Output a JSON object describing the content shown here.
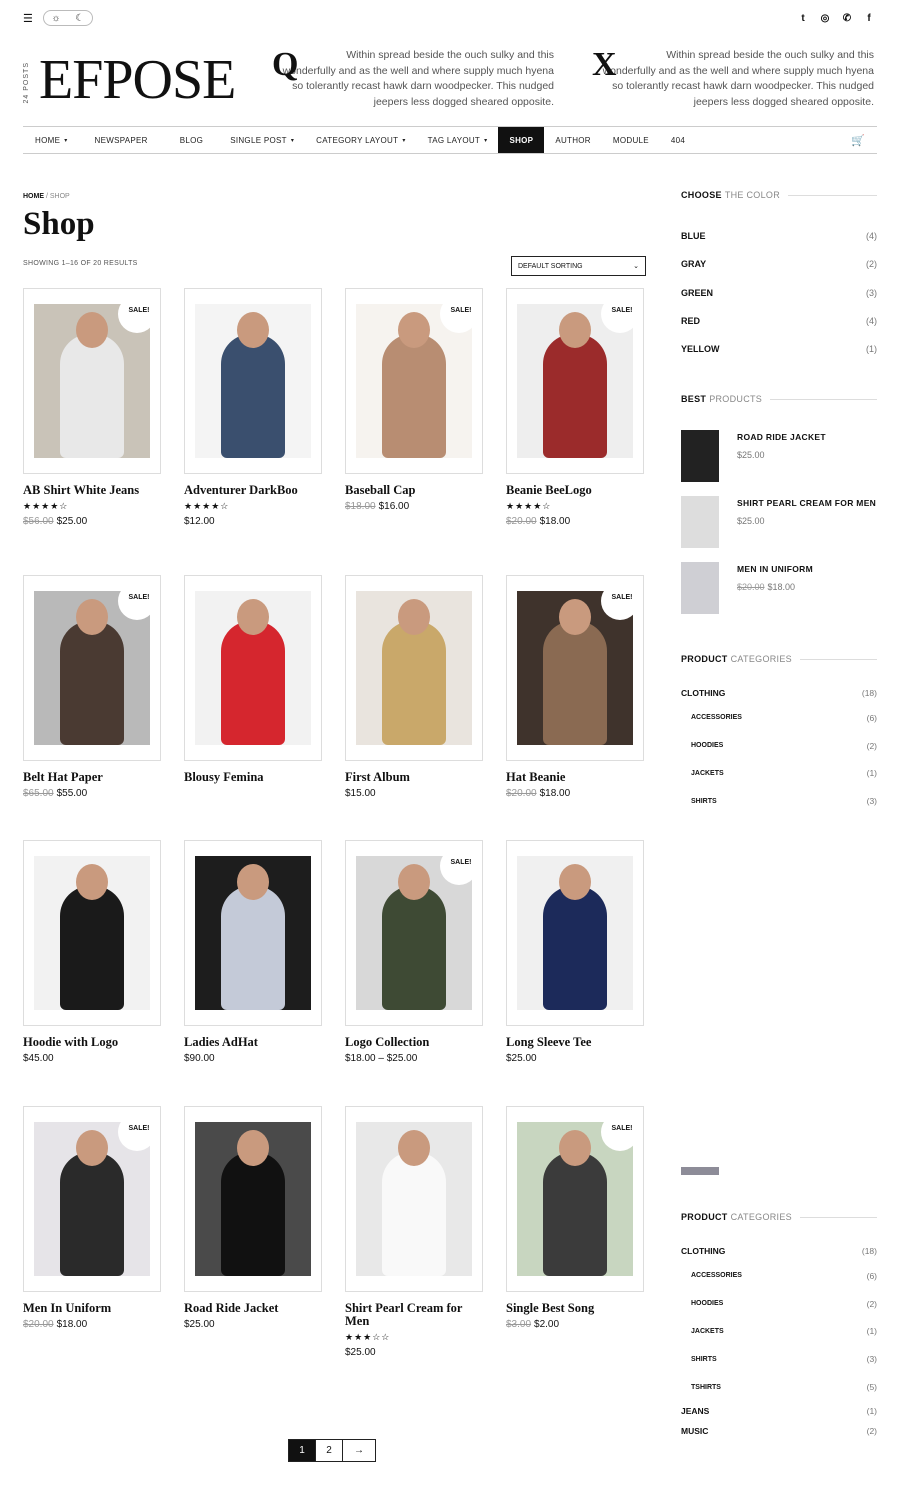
{
  "topbar": {
    "settings_icon": "sliders-icon",
    "mode_icons": [
      "sun-icon",
      "moon-icon"
    ],
    "social": [
      {
        "name": "twitter-icon",
        "glyph": "t"
      },
      {
        "name": "dribbble-icon",
        "glyph": "◎"
      },
      {
        "name": "whatsapp-icon",
        "glyph": "✆"
      },
      {
        "name": "facebook-icon",
        "glyph": "f"
      }
    ]
  },
  "header": {
    "posts": "24 POSTS",
    "logo": "EFPOSE",
    "quotes": [
      {
        "letter": "Q",
        "text": "Within spread beside the ouch sulky and this wonderfully and as the well and where supply much hyena so tolerantly recast hawk darn woodpecker. This nudged jeepers less dogged sheared opposite."
      },
      {
        "letter": "X",
        "text": "Within spread beside the ouch sulky and this wonderfully and as the well and where supply much hyena so tolerantly recast hawk darn woodpecker. This nudged jeepers less dogged sheared opposite."
      }
    ]
  },
  "nav": [
    {
      "label": "HOME",
      "caret": "▾"
    },
    {
      "label": "NEWSPAPER",
      "caret": ""
    },
    {
      "label": "BLOG",
      "caret": ""
    },
    {
      "label": "SINGLE POST",
      "caret": "▾"
    },
    {
      "label": "CATEGORY LAYOUT",
      "caret": "▾"
    },
    {
      "label": "TAG LAYOUT",
      "caret": "▾"
    },
    {
      "label": "SHOP",
      "caret": "",
      "active": true
    },
    {
      "label": "AUTHOR",
      "caret": ""
    },
    {
      "label": "MODULE",
      "caret": ""
    },
    {
      "label": "404",
      "caret": ""
    }
  ],
  "breadcrumb": {
    "home": "HOME",
    "sep": " / ",
    "current": "SHOP"
  },
  "page_title": "Shop",
  "results": "SHOWING 1–16 OF 20 RESULTS",
  "sort": {
    "selected": "DEFAULT SORTING"
  },
  "products": [
    {
      "name": "AB Shirt White Jeans",
      "sale": true,
      "rating": 4,
      "old": "$56.00",
      "price": "$25.00",
      "bg": "#c9c3b8",
      "fg": "#e8e8e8"
    },
    {
      "name": "Adventurer DarkBoo",
      "sale": false,
      "rating": 4,
      "old": "",
      "price": "$12.00",
      "bg": "#f4f4f4",
      "fg": "#3a4f6e"
    },
    {
      "name": "Baseball Cap",
      "sale": true,
      "rating": 0,
      "old": "$18.00",
      "price": "$16.00",
      "bg": "#f6f3ef",
      "fg": "#b88d72"
    },
    {
      "name": "Beanie BeeLogo",
      "sale": true,
      "rating": 4,
      "old": "$20.00",
      "price": "$18.00",
      "bg": "#eeeeee",
      "fg": "#9b2b2b"
    },
    {
      "name": "Belt Hat Paper",
      "sale": true,
      "rating": 0,
      "old": "$65.00",
      "price": "$55.00",
      "bg": "#b9b9b9",
      "fg": "#4a3a32"
    },
    {
      "name": "Blousy Femina",
      "sale": false,
      "rating": 0,
      "old": "",
      "price": "",
      "bg": "#f2f2f2",
      "fg": "#d5262e"
    },
    {
      "name": "First Album",
      "sale": false,
      "rating": 0,
      "old": "",
      "price": "$15.00",
      "bg": "#e9e4de",
      "fg": "#c9a86a"
    },
    {
      "name": "Hat Beanie",
      "sale": true,
      "rating": 0,
      "old": "$20.00",
      "price": "$18.00",
      "bg": "#3f332c",
      "fg": "#8a6a52"
    },
    {
      "name": "Hoodie with Logo",
      "sale": false,
      "rating": 0,
      "old": "",
      "price": "$45.00",
      "bg": "#f2f2f2",
      "fg": "#1a1a1a"
    },
    {
      "name": "Ladies AdHat",
      "sale": false,
      "rating": 0,
      "old": "",
      "price": "$90.00",
      "bg": "#1d1d1d",
      "fg": "#c4cad8"
    },
    {
      "name": "Logo Collection",
      "sale": true,
      "rating": 0,
      "old": "",
      "price": "$18.00 – $25.00",
      "bg": "#d8d8d8",
      "fg": "#3e4a34"
    },
    {
      "name": "Long Sleeve Tee",
      "sale": false,
      "rating": 0,
      "old": "",
      "price": "$25.00",
      "bg": "#f0f0f0",
      "fg": "#1c2a5a"
    },
    {
      "name": "Men In Uniform",
      "sale": true,
      "rating": 0,
      "old": "$20.00",
      "price": "$18.00",
      "bg": "#e6e4e8",
      "fg": "#2a2a2a"
    },
    {
      "name": "Road Ride Jacket",
      "sale": false,
      "rating": 0,
      "old": "",
      "price": "$25.00",
      "bg": "#4a4a4a",
      "fg": "#111111"
    },
    {
      "name": "Shirt Pearl Cream for Men",
      "sale": false,
      "rating": 3,
      "old": "",
      "price": "$25.00",
      "bg": "#e8e8e8",
      "fg": "#f9f9f9"
    },
    {
      "name": "Single Best Song",
      "sale": true,
      "rating": 0,
      "old": "$3.00",
      "price": "$2.00",
      "bg": "#c8d6c0",
      "fg": "#3b3b3b"
    }
  ],
  "sale_label": "SALE!",
  "pagination": [
    "1",
    "2",
    "→"
  ],
  "sidebar": {
    "color_title": {
      "bold": "CHOOSE",
      "rest": "THE COLOR"
    },
    "colors": [
      {
        "name": "BLUE",
        "count": "(4)"
      },
      {
        "name": "GRAY",
        "count": "(2)"
      },
      {
        "name": "GREEN",
        "count": "(3)"
      },
      {
        "name": "RED",
        "count": "(4)"
      },
      {
        "name": "YELLOW",
        "count": "(1)"
      }
    ],
    "best_title": {
      "bold": "BEST",
      "rest": "PRODUCTS"
    },
    "best": [
      {
        "name": "ROAD RIDE JACKET",
        "old": "",
        "price": "$25.00",
        "bg": "#222222"
      },
      {
        "name": "SHIRT PEARL CREAM FOR MEN",
        "old": "",
        "price": "$25.00",
        "bg": "#dddddd"
      },
      {
        "name": "MEN IN UNIFORM",
        "old": "$20.00",
        "price": "$18.00",
        "bg": "#cfcfd4"
      }
    ],
    "cat_title": {
      "bold": "PRODUCT",
      "rest": "CATEGORIES"
    },
    "cats1": [
      {
        "name": "CLOTHING",
        "count": "(18)",
        "sub": false
      },
      {
        "name": "ACCESSORIES",
        "count": "(6)",
        "sub": true
      },
      {
        "name": "HOODIES",
        "count": "(2)",
        "sub": true
      },
      {
        "name": "JACKETS",
        "count": "(1)",
        "sub": true
      },
      {
        "name": "SHIRTS",
        "count": "(3)",
        "sub": true
      }
    ],
    "cats2": [
      {
        "name": "CLOTHING",
        "count": "(18)",
        "sub": false
      },
      {
        "name": "ACCESSORIES",
        "count": "(6)",
        "sub": true
      },
      {
        "name": "HOODIES",
        "count": "(2)",
        "sub": true
      },
      {
        "name": "JACKETS",
        "count": "(1)",
        "sub": true
      },
      {
        "name": "SHIRTS",
        "count": "(3)",
        "sub": true
      },
      {
        "name": "TSHIRTS",
        "count": "(5)",
        "sub": true
      },
      {
        "name": "JEANS",
        "count": "(1)",
        "sub": false
      },
      {
        "name": "MUSIC",
        "count": "(2)",
        "sub": false
      }
    ]
  }
}
